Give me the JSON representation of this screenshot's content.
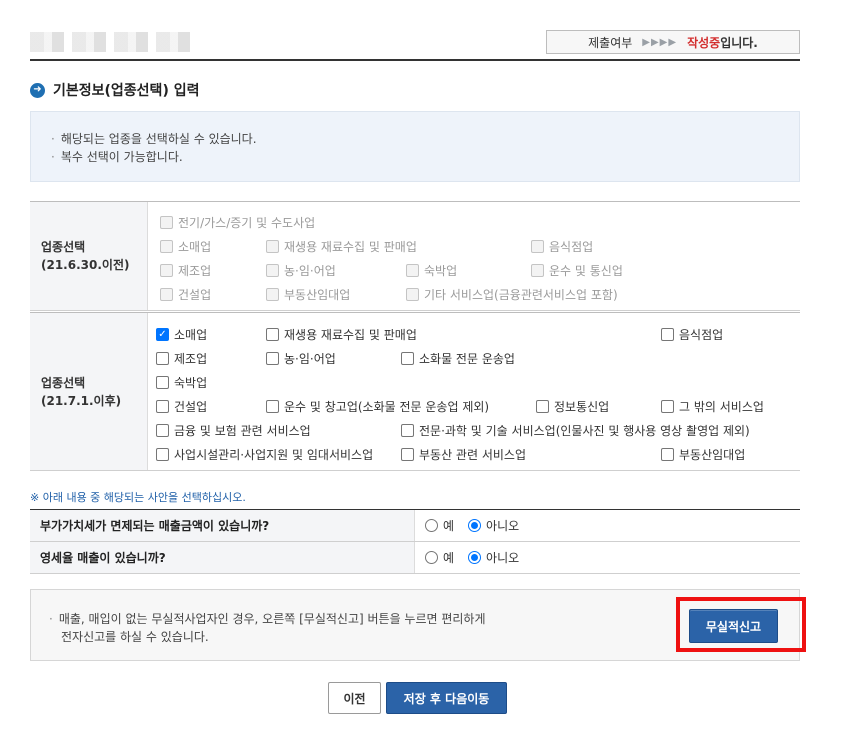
{
  "header": {
    "status_label": "제출여부",
    "status_arrows": "▶▶▶▶",
    "status_value": "작성중",
    "status_suffix": "입니다."
  },
  "section": {
    "title": "기본정보(업종선택) 입력"
  },
  "notice": {
    "lines": [
      "해당되는 업종을 선택하실 수 있습니다.",
      "복수 선택이 가능합니다."
    ]
  },
  "old_industry": {
    "label_line1": "업종선택",
    "label_line2": "(21.6.30.이전)",
    "items": [
      "전기/가스/증기 및 수도사업",
      "소매업",
      "재생용 재료수집 및 판매업",
      "음식점업",
      "제조업",
      "농·임·어업",
      "숙박업",
      "운수 및 통신업",
      "건설업",
      "부동산임대업",
      "기타 서비스업(금융관련서비스업 포함)"
    ]
  },
  "new_industry": {
    "label_line1": "업종선택",
    "label_line2": "(21.7.1.이후)",
    "items": [
      {
        "label": "소매업",
        "checked": true
      },
      {
        "label": "재생용 재료수집 및 판매업",
        "checked": false
      },
      {
        "label": "음식점업",
        "checked": false
      },
      {
        "label": "제조업",
        "checked": false
      },
      {
        "label": "농·임·어업",
        "checked": false
      },
      {
        "label": "소화물 전문 운송업",
        "checked": false
      },
      {
        "label": "숙박업",
        "checked": false
      },
      {
        "label": "건설업",
        "checked": false
      },
      {
        "label": "운수 및 창고업(소화물 전문 운송업 제외)",
        "checked": false
      },
      {
        "label": "정보통신업",
        "checked": false
      },
      {
        "label": "그 밖의 서비스업",
        "checked": false
      },
      {
        "label": "금융 및 보험 관련 서비스업",
        "checked": false
      },
      {
        "label": "전문·과학 및 기술 서비스업(인물사진 및 행사용 영상 촬영업 제외)",
        "checked": false
      },
      {
        "label": "사업시설관리·사업지원 및 임대서비스업",
        "checked": false
      },
      {
        "label": "부동산 관련 서비스업",
        "checked": false
      },
      {
        "label": "부동산임대업",
        "checked": false
      }
    ]
  },
  "guide": "※ 아래 내용 중 해당되는 사안을 선택하십시오.",
  "questions": [
    {
      "label": "부가가치세가 면제되는 매출금액이 있습니까?",
      "yes": "예",
      "no": "아니오",
      "selected": "no"
    },
    {
      "label": "영세율 매출이 있습니까?",
      "yes": "예",
      "no": "아니오",
      "selected": "no"
    }
  ],
  "info": {
    "line1": "매출, 매입이 없는 무실적사업자인 경우, 오른쪽 [무실적신고] 버튼을 누르면 편리하게",
    "line2": "전자신고를 하실 수 있습니다.",
    "button": "무실적신고"
  },
  "footer": {
    "prev": "이전",
    "next": "저장 후 다음이동"
  },
  "colors": {
    "accent": "#2b63a8",
    "status": "#d32f2f",
    "highlight": "#ee1111",
    "checkbox": "#0075ff"
  }
}
